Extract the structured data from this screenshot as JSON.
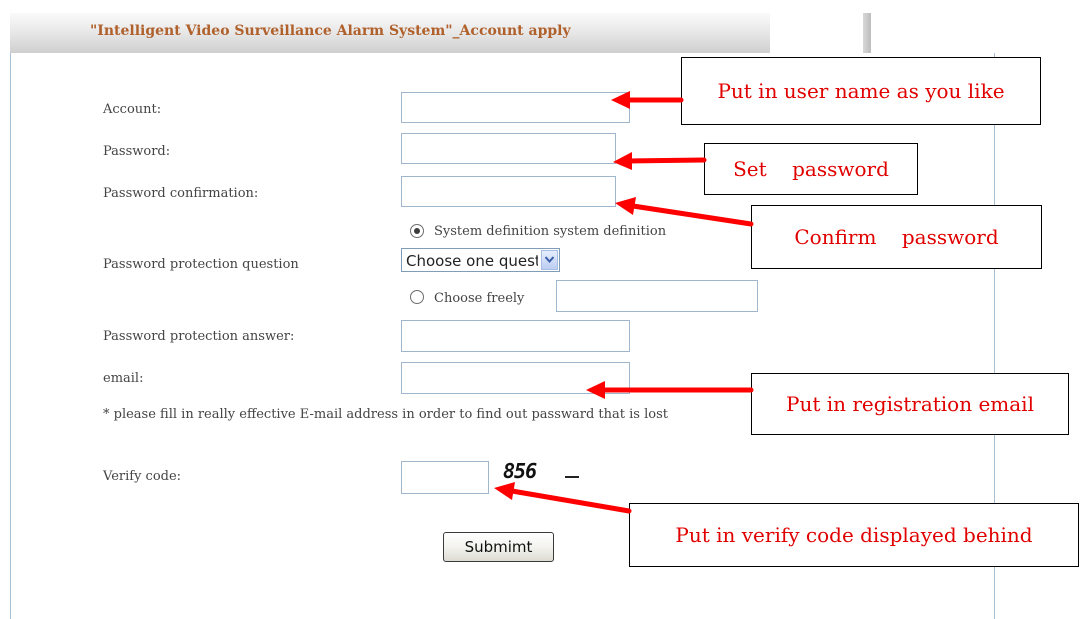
{
  "header": {
    "title": "\"Intelligent Video Surveillance Alarm System\"_Account apply"
  },
  "form": {
    "account_label": "Account:",
    "password_label": "Password:",
    "password_confirm_label": "Password confirmation:",
    "question_label": "Password protection question",
    "radio_system_label": "System definition system definition",
    "radio_system_checked": true,
    "question_select_value": "Choose one questic",
    "radio_free_label": "Choose freely",
    "answer_label": "Password protection answer:",
    "email_label": "email:",
    "email_note": "* please fill in really effective E-mail address in order to find out passward that is lost",
    "verify_label": "Verify code:",
    "captcha_text": "856",
    "submit_label": "Submimt"
  },
  "callouts": {
    "account": "Put in user name as you like",
    "password": "Set    password",
    "confirm": "Confirm    password",
    "email": "Put in registration email",
    "verify": "Put in verify code displayed behind"
  },
  "colors": {
    "title": "#b0602b",
    "callout_text": "#e10000",
    "arrow": "#ff0000",
    "input_border": "#9fb6cc"
  },
  "icons": {
    "select_arrow": "chevron-down-icon"
  }
}
